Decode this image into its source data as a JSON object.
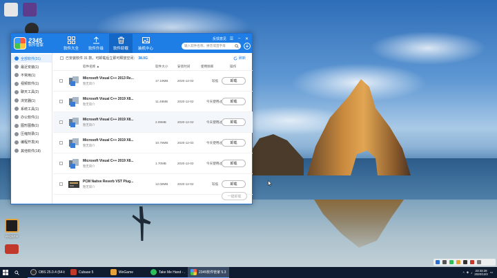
{
  "desktop": {
    "icons": [
      {
        "name": "desktop-icon-1",
        "label": "",
        "color": "#d9d9d9"
      },
      {
        "name": "desktop-icon-2",
        "label": "",
        "color": "#5e3c8c"
      },
      {
        "name": "desktop-icon-3",
        "label": "",
        "color": "#333333"
      },
      {
        "name": "desktop-icon-bottom",
        "label": "wegame",
        "color": "#222222"
      }
    ]
  },
  "window": {
    "logo": {
      "number": "2345",
      "subtitle": "软件管家"
    },
    "nav_tabs": [
      {
        "label": "软件大全",
        "icon": "grid-icon"
      },
      {
        "label": "软件升级",
        "icon": "upload-icon"
      },
      {
        "label": "软件卸载",
        "icon": "trash-icon",
        "active": true
      },
      {
        "label": "装机中心",
        "icon": "image-icon"
      }
    ],
    "titlebar_text": "反馈意见",
    "search_placeholder": "输入软件名称，拼音或首字母",
    "sidebar": [
      {
        "label": "全部软件(31)",
        "active": true
      },
      {
        "label": "最近安装(1)"
      },
      {
        "label": "不常用(1)"
      },
      {
        "label": "视频软件(1)"
      },
      {
        "label": "聊天工具(2)"
      },
      {
        "label": "浏览器(1)"
      },
      {
        "label": "系统工具(1)"
      },
      {
        "label": "办公软件(1)"
      },
      {
        "label": "图形图像(1)"
      },
      {
        "label": "压缩刻录(1)"
      },
      {
        "label": "编程开发(4)"
      },
      {
        "label": "其他软件(18)"
      }
    ],
    "info": {
      "prefix": "已安装软件 31 款，可卸载后立即可释放空间：",
      "size": "38.0G",
      "refresh": "刷新"
    },
    "columns": {
      "name": "软件名称",
      "size": "软件大小",
      "date": "安装时间",
      "freq": "使用频率",
      "action": "操作"
    },
    "rows": [
      {
        "name": "Microsoft Visual C++ 2013 Re...",
        "publisher": "暂无简介",
        "size": "17.19MB",
        "date": "2020-12-02",
        "freq": "较低",
        "action": "卸载"
      },
      {
        "name": "Microsoft Visual C++ 2019 X8...",
        "publisher": "暂无简介",
        "size": "11.49MB",
        "date": "2020-12-02",
        "freq": "今天使用过",
        "action": "卸载"
      },
      {
        "name": "Microsoft Visual C++ 2019 X8...",
        "publisher": "暂无简介",
        "size": "2.09MB",
        "date": "2020-12-02",
        "freq": "今天使用过",
        "action": "卸载"
      },
      {
        "name": "Microsoft Visual C++ 2019 X8...",
        "publisher": "暂无简介",
        "size": "10.78MB",
        "date": "2020-12-02",
        "freq": "今天使用过",
        "action": "卸载"
      },
      {
        "name": "Microsoft Visual C++ 2019 X8...",
        "publisher": "暂无简介",
        "size": "1.70MB",
        "date": "2020-12-02",
        "freq": "今天使用过",
        "action": "卸载"
      },
      {
        "name": "PCM Native Reverb VST Plug...",
        "publisher": "暂无简介",
        "size": "12.08MB",
        "date": "2020-12-02",
        "freq": "较低",
        "action": "卸载"
      }
    ],
    "batch_button": "一键卸载"
  },
  "taskbar": {
    "items": [
      {
        "label": "OBS 25.0.4 (64-bi...",
        "color": "#2b2b2b"
      },
      {
        "label": "Cubase 5",
        "color": "#c0392b"
      },
      {
        "label": "WeGame",
        "color": "#e5a23a"
      },
      {
        "label": "Take Me Hand - ...",
        "color": "#2ebd59"
      },
      {
        "label": "2345软件管家 5.3",
        "color": "#3c8fe8",
        "active": true
      }
    ],
    "clock": {
      "time": "23:33:28",
      "date": "2020/12/2"
    }
  },
  "colors": {
    "accent": "#1e7ee6",
    "taskbar": "#0f1b2e"
  }
}
